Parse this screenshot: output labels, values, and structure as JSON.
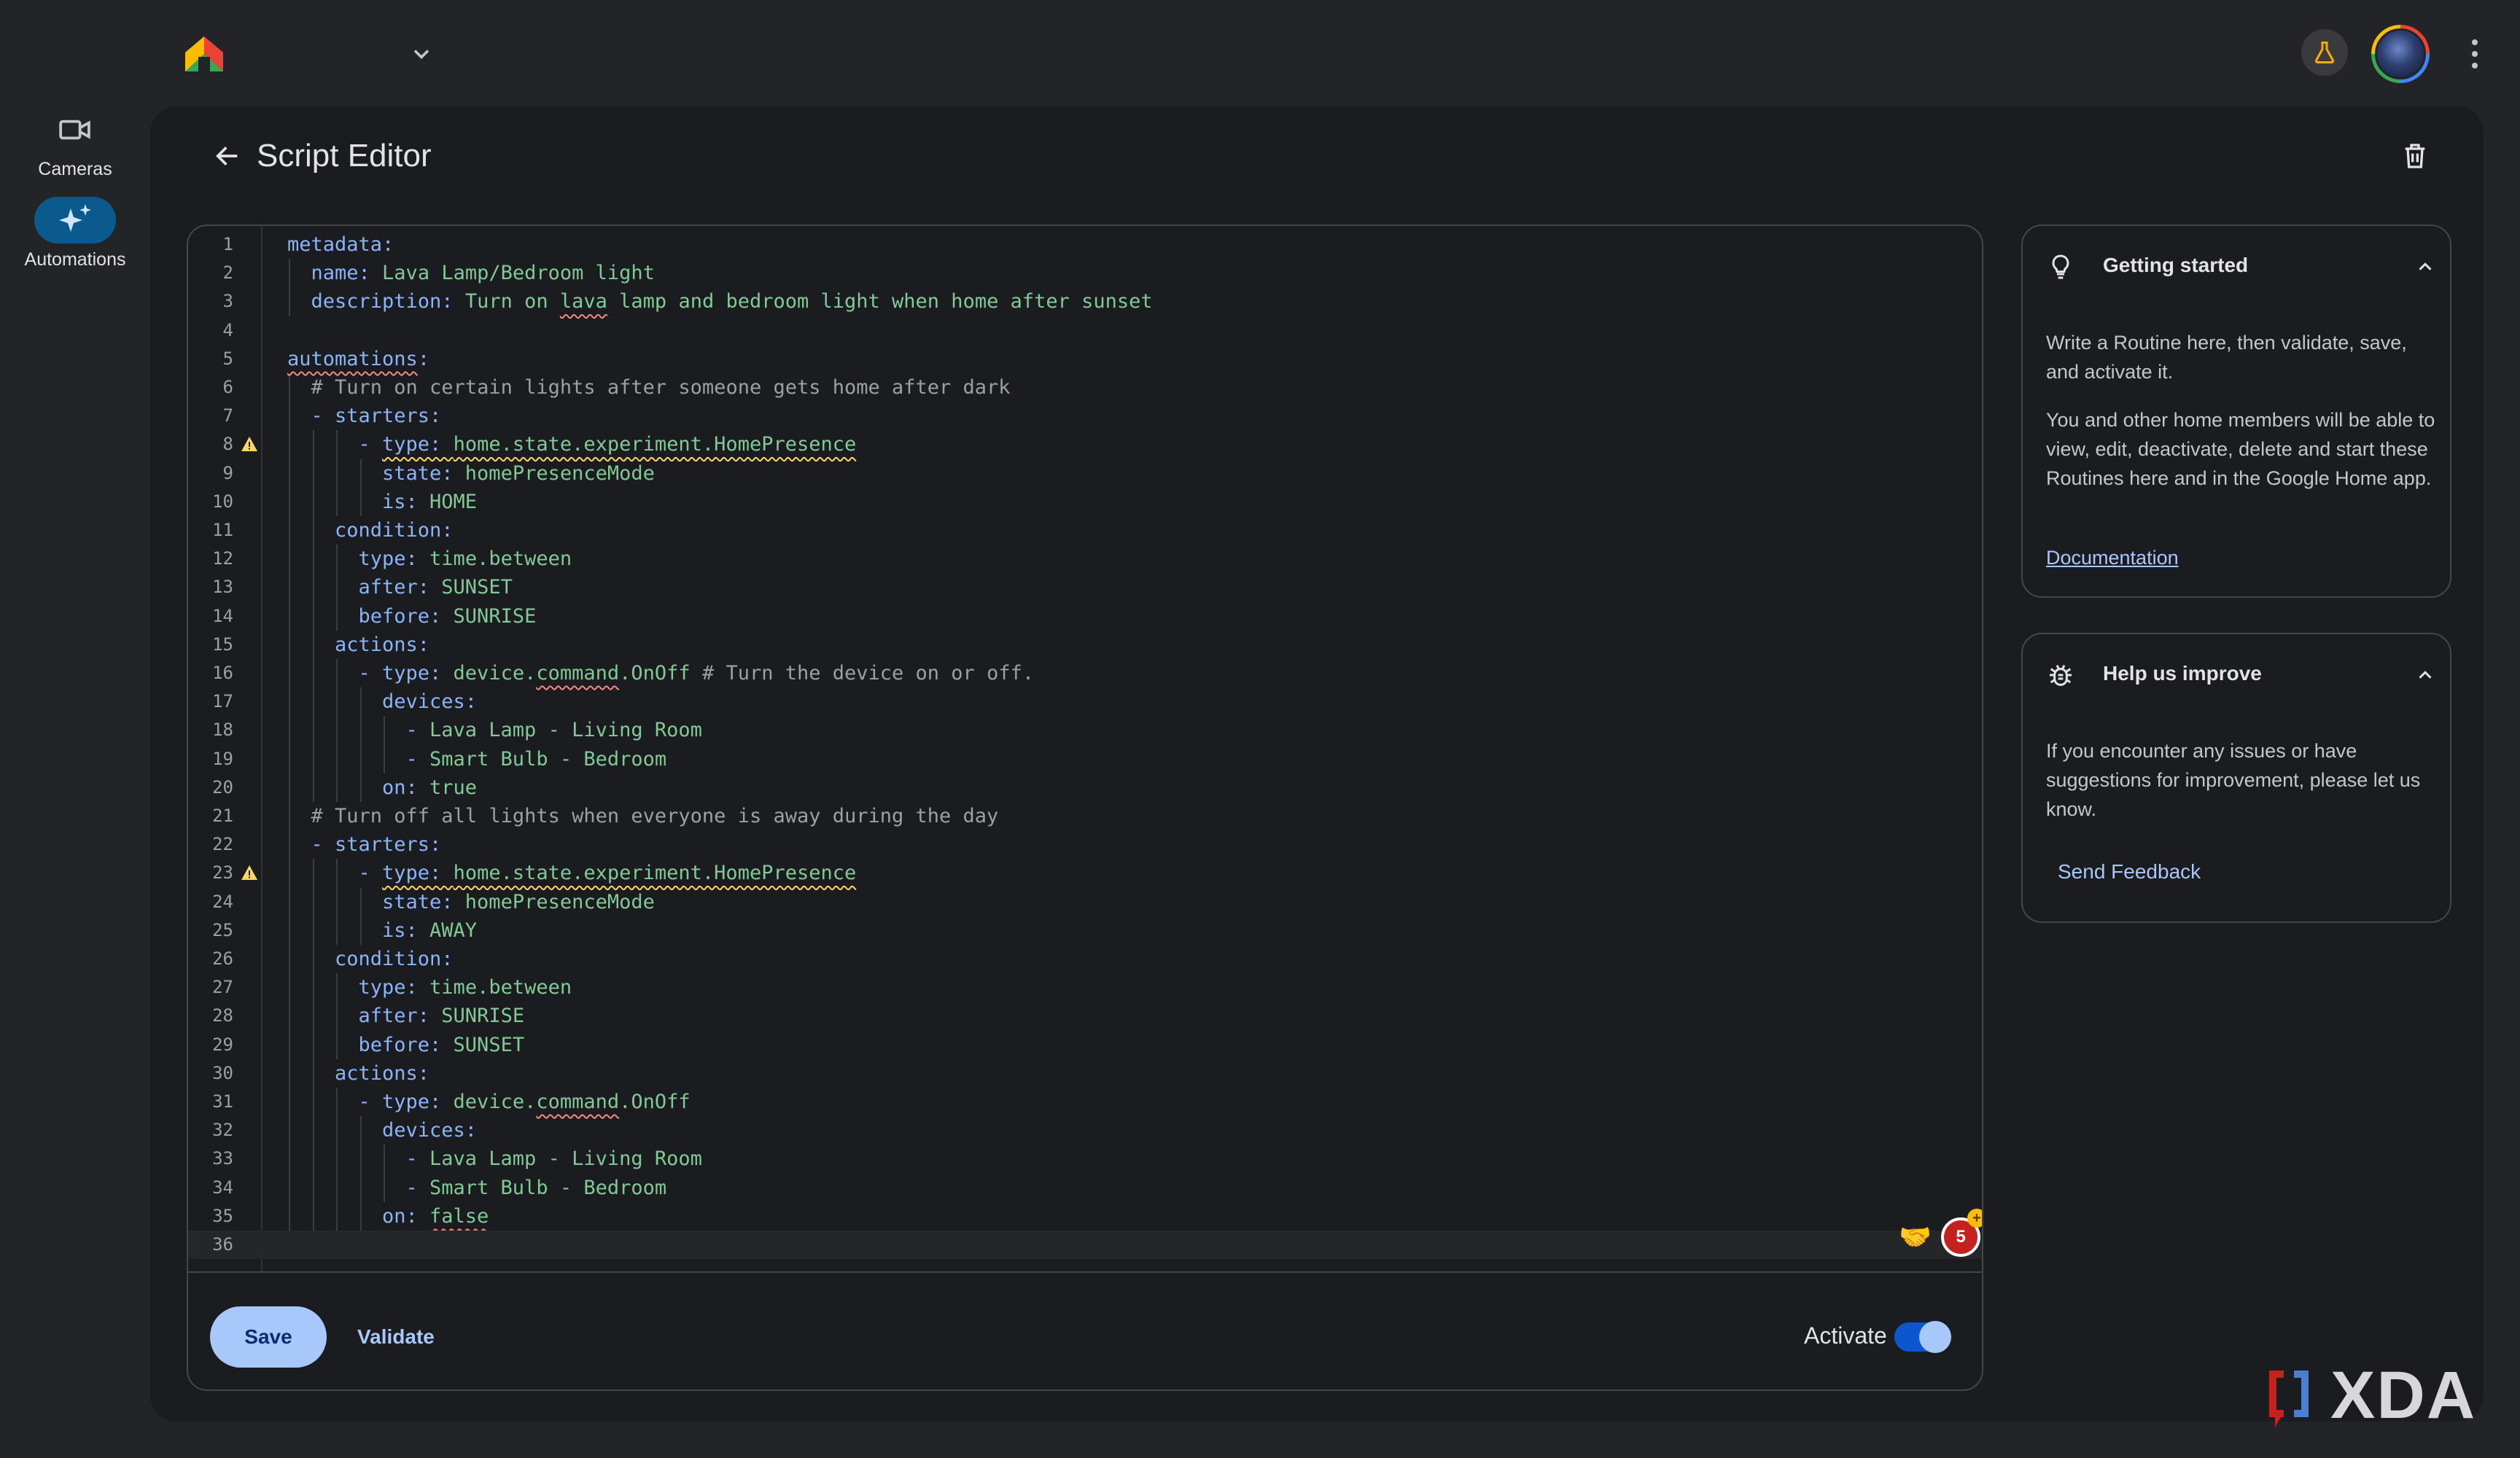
{
  "rail": {
    "cameras_label": "Cameras",
    "automations_label": "Automations"
  },
  "editor": {
    "title": "Script Editor",
    "lines": [
      {
        "n": "1",
        "indent": 0,
        "segs": [
          {
            "t": "metadata:",
            "c": "k"
          }
        ]
      },
      {
        "n": "2",
        "indent": 2,
        "segs": [
          {
            "t": "name: ",
            "c": "k"
          },
          {
            "t": "Lava Lamp/Bedroom light",
            "c": "v"
          }
        ]
      },
      {
        "n": "3",
        "indent": 2,
        "segs": [
          {
            "t": "description: ",
            "c": "k"
          },
          {
            "t": "Turn on ",
            "c": "v"
          },
          {
            "t": "lava",
            "c": "v",
            "u": "err"
          },
          {
            "t": " lamp and bedroom light when home after sunset",
            "c": "v"
          }
        ]
      },
      {
        "n": "4",
        "indent": 0,
        "segs": []
      },
      {
        "n": "5",
        "indent": 0,
        "segs": [
          {
            "t": "automations",
            "c": "k",
            "u": "err"
          },
          {
            "t": ":",
            "c": "k"
          }
        ]
      },
      {
        "n": "6",
        "indent": 2,
        "segs": [
          {
            "t": "# Turn on certain lights after someone gets home after dark",
            "c": "c"
          }
        ]
      },
      {
        "n": "7",
        "indent": 2,
        "segs": [
          {
            "t": "- starters:",
            "c": "k"
          }
        ]
      },
      {
        "n": "8",
        "indent": 6,
        "warn": true,
        "segs": [
          {
            "t": "- ",
            "c": "k"
          },
          {
            "t": "type: home.state.experiment.HomePresence",
            "c": "k",
            "u": "warn",
            "split": true
          }
        ]
      },
      {
        "n": "9",
        "indent": 8,
        "segs": [
          {
            "t": "state: ",
            "c": "k"
          },
          {
            "t": "homePresenceMode",
            "c": "v"
          }
        ]
      },
      {
        "n": "10",
        "indent": 8,
        "segs": [
          {
            "t": "is: ",
            "c": "k"
          },
          {
            "t": "HOME",
            "c": "v"
          }
        ]
      },
      {
        "n": "11",
        "indent": 4,
        "segs": [
          {
            "t": "condition:",
            "c": "k"
          }
        ]
      },
      {
        "n": "12",
        "indent": 6,
        "segs": [
          {
            "t": "type: ",
            "c": "k"
          },
          {
            "t": "time.between",
            "c": "v"
          }
        ]
      },
      {
        "n": "13",
        "indent": 6,
        "segs": [
          {
            "t": "after: ",
            "c": "k"
          },
          {
            "t": "SUNSET",
            "c": "v"
          }
        ]
      },
      {
        "n": "14",
        "indent": 6,
        "segs": [
          {
            "t": "before: ",
            "c": "k"
          },
          {
            "t": "SUNRISE",
            "c": "v"
          }
        ]
      },
      {
        "n": "15",
        "indent": 4,
        "segs": [
          {
            "t": "actions:",
            "c": "k"
          }
        ]
      },
      {
        "n": "16",
        "indent": 6,
        "segs": [
          {
            "t": "- type: ",
            "c": "k"
          },
          {
            "t": "device.",
            "c": "v"
          },
          {
            "t": "command",
            "c": "v",
            "u": "err"
          },
          {
            "t": ".OnOff ",
            "c": "v"
          },
          {
            "t": "# Turn the device on or off.",
            "c": "c"
          }
        ]
      },
      {
        "n": "17",
        "indent": 8,
        "segs": [
          {
            "t": "devices:",
            "c": "k"
          }
        ]
      },
      {
        "n": "18",
        "indent": 10,
        "segs": [
          {
            "t": "- ",
            "c": "k"
          },
          {
            "t": "Lava Lamp - Living Room",
            "c": "v"
          }
        ]
      },
      {
        "n": "19",
        "indent": 10,
        "segs": [
          {
            "t": "- ",
            "c": "k"
          },
          {
            "t": "Smart Bulb - Bedroom",
            "c": "v"
          }
        ]
      },
      {
        "n": "20",
        "indent": 8,
        "segs": [
          {
            "t": "on: ",
            "c": "k"
          },
          {
            "t": "true",
            "c": "v"
          }
        ]
      },
      {
        "n": "21",
        "indent": 2,
        "segs": [
          {
            "t": "# Turn off all lights when everyone is away during the day",
            "c": "c"
          }
        ]
      },
      {
        "n": "22",
        "indent": 2,
        "segs": [
          {
            "t": "- starters:",
            "c": "k"
          }
        ]
      },
      {
        "n": "23",
        "indent": 6,
        "warn": true,
        "segs": [
          {
            "t": "- ",
            "c": "k"
          },
          {
            "t": "type: home.state.experiment.HomePresence",
            "c": "k",
            "u": "warn",
            "split": true
          }
        ]
      },
      {
        "n": "24",
        "indent": 8,
        "segs": [
          {
            "t": "state: ",
            "c": "k"
          },
          {
            "t": "homePresenceMode",
            "c": "v"
          }
        ]
      },
      {
        "n": "25",
        "indent": 8,
        "segs": [
          {
            "t": "is: ",
            "c": "k"
          },
          {
            "t": "AWAY",
            "c": "v"
          }
        ]
      },
      {
        "n": "26",
        "indent": 4,
        "segs": [
          {
            "t": "condition:",
            "c": "k"
          }
        ]
      },
      {
        "n": "27",
        "indent": 6,
        "segs": [
          {
            "t": "type: ",
            "c": "k"
          },
          {
            "t": "time.between",
            "c": "v"
          }
        ]
      },
      {
        "n": "28",
        "indent": 6,
        "segs": [
          {
            "t": "after: ",
            "c": "k"
          },
          {
            "t": "SUNRISE",
            "c": "v"
          }
        ]
      },
      {
        "n": "29",
        "indent": 6,
        "segs": [
          {
            "t": "before: ",
            "c": "k"
          },
          {
            "t": "SUNSET",
            "c": "v"
          }
        ]
      },
      {
        "n": "30",
        "indent": 4,
        "segs": [
          {
            "t": "actions:",
            "c": "k"
          }
        ]
      },
      {
        "n": "31",
        "indent": 6,
        "segs": [
          {
            "t": "- type: ",
            "c": "k"
          },
          {
            "t": "device.",
            "c": "v"
          },
          {
            "t": "command",
            "c": "v",
            "u": "err"
          },
          {
            "t": ".OnOff",
            "c": "v"
          }
        ]
      },
      {
        "n": "32",
        "indent": 8,
        "segs": [
          {
            "t": "devices:",
            "c": "k"
          }
        ]
      },
      {
        "n": "33",
        "indent": 10,
        "segs": [
          {
            "t": "- ",
            "c": "k"
          },
          {
            "t": "Lava Lamp - Living Room",
            "c": "v"
          }
        ]
      },
      {
        "n": "34",
        "indent": 10,
        "segs": [
          {
            "t": "- ",
            "c": "k"
          },
          {
            "t": "Smart Bulb - Bedroom",
            "c": "v"
          }
        ]
      },
      {
        "n": "35",
        "indent": 8,
        "segs": [
          {
            "t": "on: ",
            "c": "k"
          },
          {
            "t": "false",
            "c": "v",
            "u": "err"
          }
        ]
      },
      {
        "n": "36",
        "indent": 0,
        "current": true,
        "segs": []
      }
    ],
    "error_count": "5",
    "save_label": "Save",
    "validate_label": "Validate",
    "activate_label": "Activate",
    "activate_on": true
  },
  "getting_started": {
    "title": "Getting started",
    "p1": "Write a Routine here, then validate, save, and activate it.",
    "p2": "You and other home members will be able to view, edit, deactivate, delete and start these Routines here and in the Google Home app.",
    "link": "Documentation"
  },
  "help_improve": {
    "title": "Help us improve",
    "p1": "If you encounter any issues or have suggestions for improvement, please let us know.",
    "link": "Send Feedback"
  },
  "watermark": "XDA",
  "colors": {
    "key": "#8ab4f8",
    "value": "#81c995",
    "comment": "#9aa0a6",
    "error_underline": "#f28b82",
    "warning": "#fdd663",
    "accent": "#a8c7fa"
  }
}
